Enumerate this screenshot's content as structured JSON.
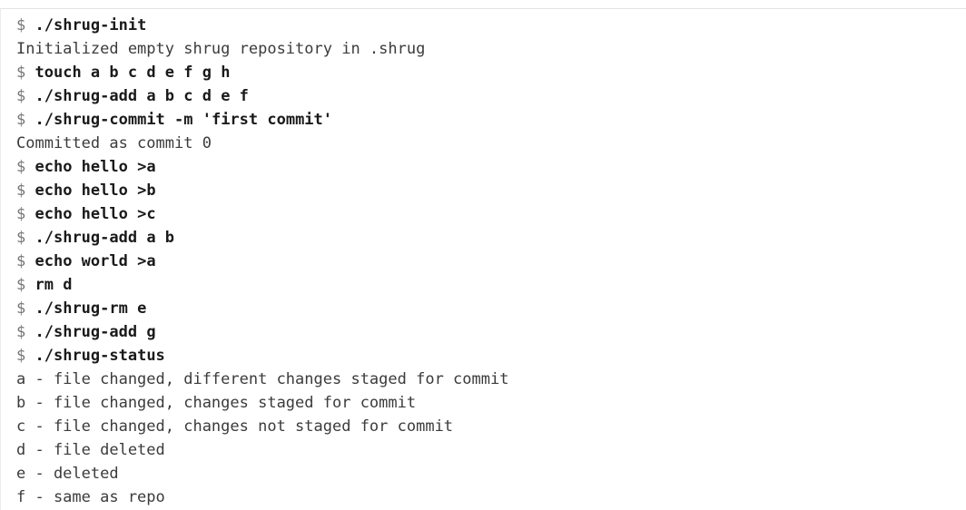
{
  "terminal": {
    "prompt": "$",
    "lines": [
      {
        "type": "command",
        "text": "./shrug-init"
      },
      {
        "type": "output",
        "text": "Initialized empty shrug repository in .shrug"
      },
      {
        "type": "command",
        "text": "touch a b c d e f g h"
      },
      {
        "type": "command",
        "text": "./shrug-add a b c d e f"
      },
      {
        "type": "command",
        "text": "./shrug-commit -m 'first commit'"
      },
      {
        "type": "output",
        "text": "Committed as commit 0"
      },
      {
        "type": "command",
        "text": "echo hello >a"
      },
      {
        "type": "command",
        "text": "echo hello >b"
      },
      {
        "type": "command",
        "text": "echo hello >c"
      },
      {
        "type": "command",
        "text": "./shrug-add a b"
      },
      {
        "type": "command",
        "text": "echo world >a"
      },
      {
        "type": "command",
        "text": "rm d"
      },
      {
        "type": "command",
        "text": "./shrug-rm e"
      },
      {
        "type": "command",
        "text": "./shrug-add g"
      },
      {
        "type": "command",
        "text": "./shrug-status"
      },
      {
        "type": "output",
        "text": "a - file changed, different changes staged for commit"
      },
      {
        "type": "output",
        "text": "b - file changed, changes staged for commit"
      },
      {
        "type": "output",
        "text": "c - file changed, changes not staged for commit"
      },
      {
        "type": "output",
        "text": "d - file deleted"
      },
      {
        "type": "output",
        "text": "e - deleted"
      },
      {
        "type": "output",
        "text": "f - same as repo"
      }
    ]
  }
}
